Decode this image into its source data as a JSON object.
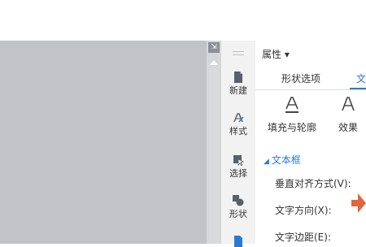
{
  "panel": {
    "title": "属性 ▾",
    "tabs": [
      {
        "label": "形状选项",
        "active": false
      },
      {
        "label": "文",
        "active": true
      }
    ],
    "subtabs": [
      {
        "label": "填充与轮廓",
        "icon": "A-underline-icon"
      },
      {
        "label": "效果",
        "icon": "A-effects-icon"
      }
    ],
    "section": {
      "toggle": "◢",
      "label": "文本框"
    },
    "rows": [
      {
        "label": "垂直对齐方式(V):"
      },
      {
        "label": "文字方向(X):"
      },
      {
        "label": "文字边距(E):"
      }
    ]
  },
  "taskpane": {
    "items": [
      {
        "label": "新建",
        "icon": "new-doc-icon"
      },
      {
        "label": "样式",
        "icon": "style-pen-icon"
      },
      {
        "label": "选择",
        "icon": "select-arrow-icon"
      },
      {
        "label": "形状",
        "icon": "shapes-icon"
      }
    ]
  },
  "colors": {
    "accent": "#2a7ad1",
    "canvas": "#c1c3c9",
    "arrow": "#e0663c"
  }
}
